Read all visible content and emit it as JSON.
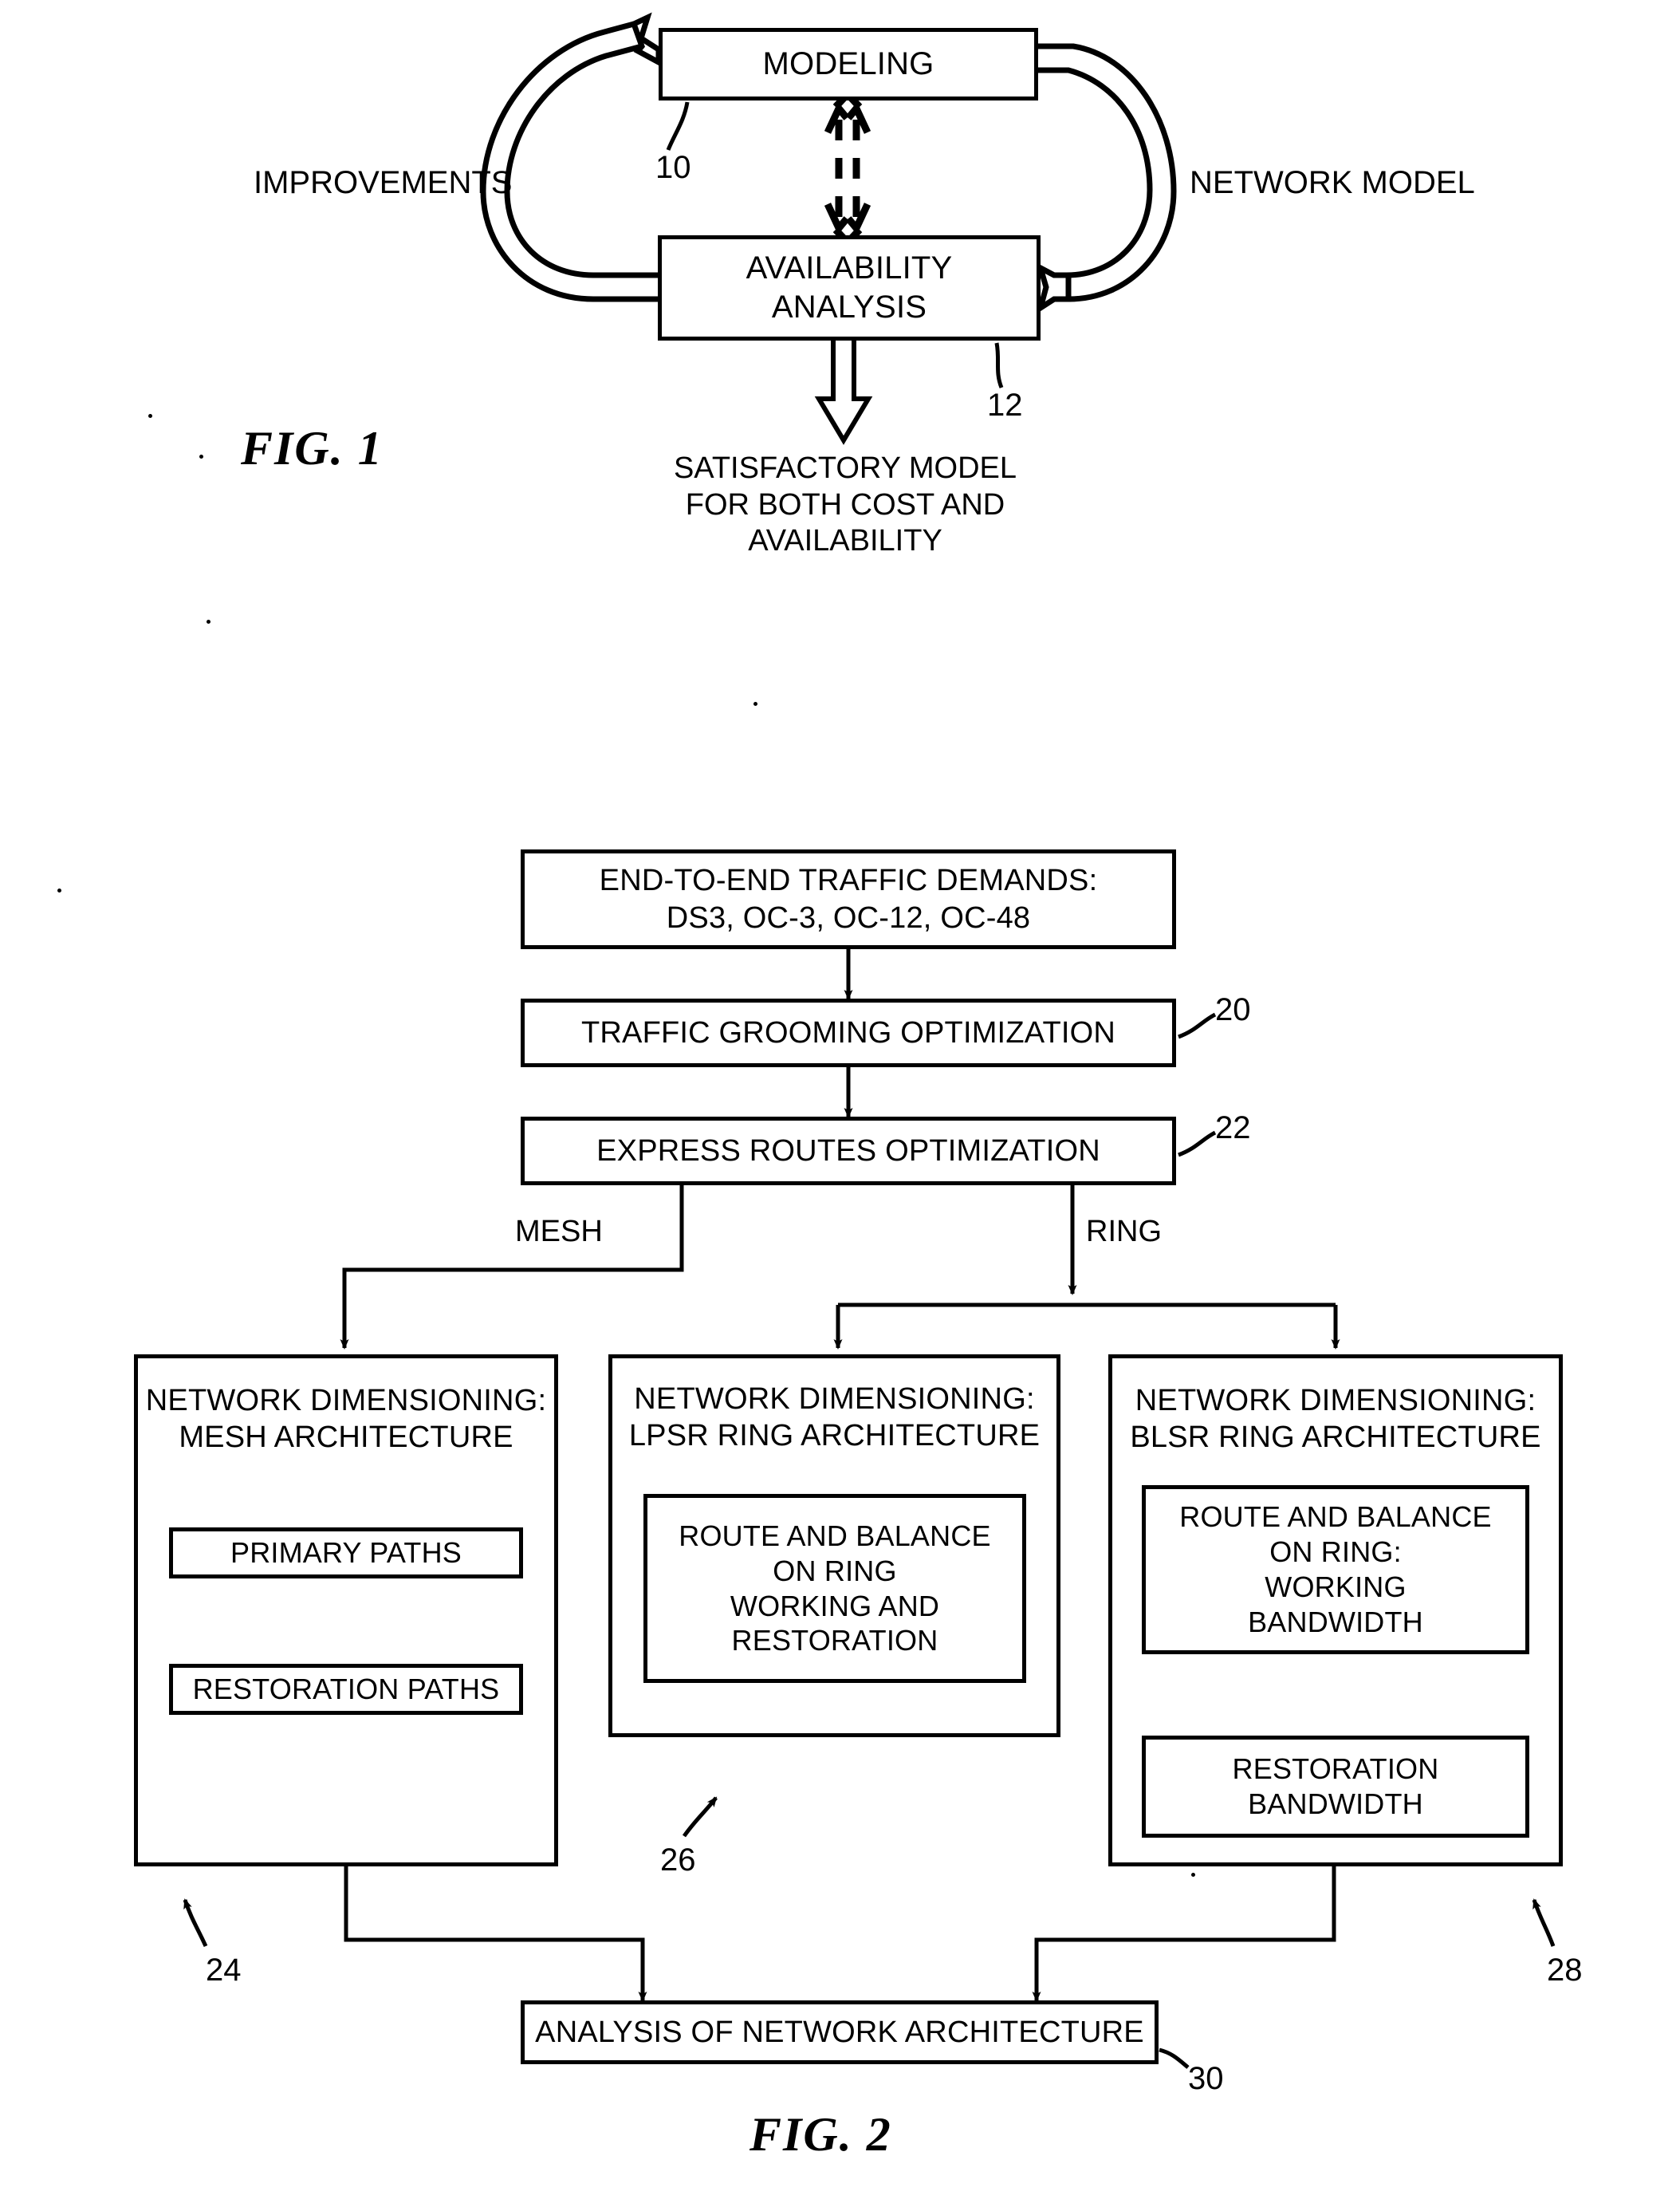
{
  "figure1": {
    "label": "FIG. 1",
    "boxes": {
      "modeling": "MODELING",
      "availability": "AVAILABILITY\nANALYSIS"
    },
    "edge_labels": {
      "improvements": "IMPROVEMENTS",
      "network_model": "NETWORK MODEL"
    },
    "output_text": "SATISFACTORY MODEL\nFOR BOTH COST AND\nAVAILABILITY",
    "ref_numbers": {
      "modeling": "10",
      "availability": "12"
    }
  },
  "figure2": {
    "label": "FIG. 2",
    "boxes": {
      "traffic_demands": "END-TO-END TRAFFIC DEMANDS:\nDS3, OC-3, OC-12, OC-48",
      "traffic_grooming": "TRAFFIC GROOMING OPTIMIZATION",
      "express_routes": "EXPRESS ROUTES OPTIMIZATION",
      "mesh_dimensioning": "NETWORK DIMENSIONING:\nMESH ARCHITECTURE",
      "mesh_primary": "PRIMARY PATHS",
      "mesh_restoration": "RESTORATION PATHS",
      "lpsr_dimensioning": "NETWORK DIMENSIONING:\nLPSR RING ARCHITECTURE",
      "lpsr_inner": "ROUTE AND BALANCE\nON RING\nWORKING AND\nRESTORATION",
      "blsr_dimensioning": "NETWORK DIMENSIONING:\nBLSR RING ARCHITECTURE",
      "blsr_inner": "ROUTE AND BALANCE\nON RING:\nWORKING\nBANDWIDTH",
      "blsr_restoration": "RESTORATION\nBANDWIDTH",
      "analysis": "ANALYSIS OF NETWORK ARCHITECTURE"
    },
    "branch_labels": {
      "mesh": "MESH",
      "ring": "RING"
    },
    "ref_numbers": {
      "traffic_grooming": "20",
      "express_routes": "22",
      "mesh": "24",
      "lpsr": "26",
      "blsr": "28",
      "analysis": "30"
    }
  },
  "colors": {
    "ink": "#000000",
    "paper": "#ffffff"
  }
}
